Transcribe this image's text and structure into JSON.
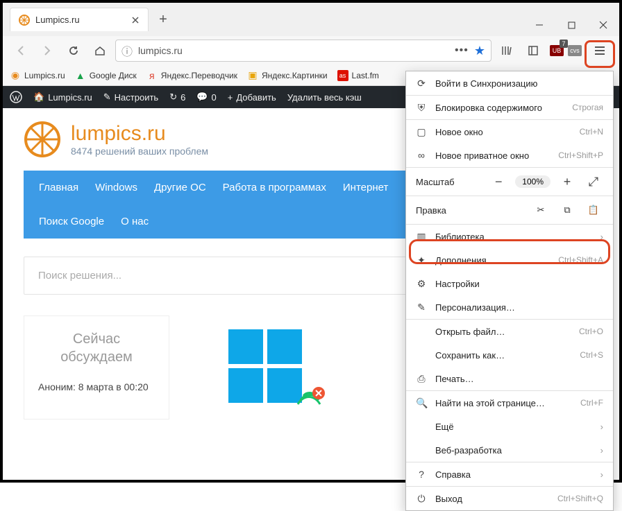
{
  "tab": {
    "title": "Lumpics.ru"
  },
  "urlbar": {
    "address": "lumpics.ru"
  },
  "bookmarks": {
    "items": [
      {
        "label": "Lumpics.ru",
        "color": "#e78b1e"
      },
      {
        "label": "Google Диск",
        "color": "#19a24b"
      },
      {
        "label": "Яндекс.Переводчик",
        "color": "#d43"
      },
      {
        "label": "Яндекс.Картинки",
        "color": "#e8a50b"
      },
      {
        "label": "Last.fm",
        "color": "#d10"
      }
    ]
  },
  "wpbar": {
    "site": "Lumpics.ru",
    "customize": "Настроить",
    "updates": "6",
    "comments": "0",
    "add": "Добавить",
    "purge": "Удалить весь кэш"
  },
  "site": {
    "name": "lumpics.ru",
    "tagline": "8474 решений ваших проблем"
  },
  "nav": {
    "row1": [
      "Главная",
      "Windows",
      "Другие ОС",
      "Работа в программах",
      "Интернет"
    ],
    "row2": [
      "Поиск Google",
      "О нас"
    ]
  },
  "search": {
    "placeholder": "Поиск решения..."
  },
  "discuss": {
    "title": "Сейчас обсуждаем",
    "entry": "Аноним: 8 марта в 00:20"
  },
  "ext": {
    "ublock_count": "7",
    "ub": "UB",
    "cvs": "cvs"
  },
  "menu": {
    "sync": "Войти в Синхронизацию",
    "block": {
      "label": "Блокировка содержимого",
      "hint": "Строгая"
    },
    "newwin": {
      "label": "Новое окно",
      "hint": "Ctrl+N"
    },
    "private": {
      "label": "Новое приватное окно",
      "hint": "Ctrl+Shift+P"
    },
    "zoom": {
      "label": "Масштаб",
      "value": "100%"
    },
    "edit": {
      "label": "Правка"
    },
    "library": "Библиотека",
    "addons": {
      "label": "Дополнения",
      "hint": "Ctrl+Shift+A"
    },
    "settings": "Настройки",
    "customize": "Персонализация…",
    "open": {
      "label": "Открыть файл…",
      "hint": "Ctrl+O"
    },
    "save": {
      "label": "Сохранить как…",
      "hint": "Ctrl+S"
    },
    "print": "Печать…",
    "find": {
      "label": "Найти на этой странице…",
      "hint": "Ctrl+F"
    },
    "more": "Ещё",
    "webdev": "Веб-разработка",
    "help": "Справка",
    "exit": {
      "label": "Выход",
      "hint": "Ctrl+Shift+Q"
    }
  }
}
